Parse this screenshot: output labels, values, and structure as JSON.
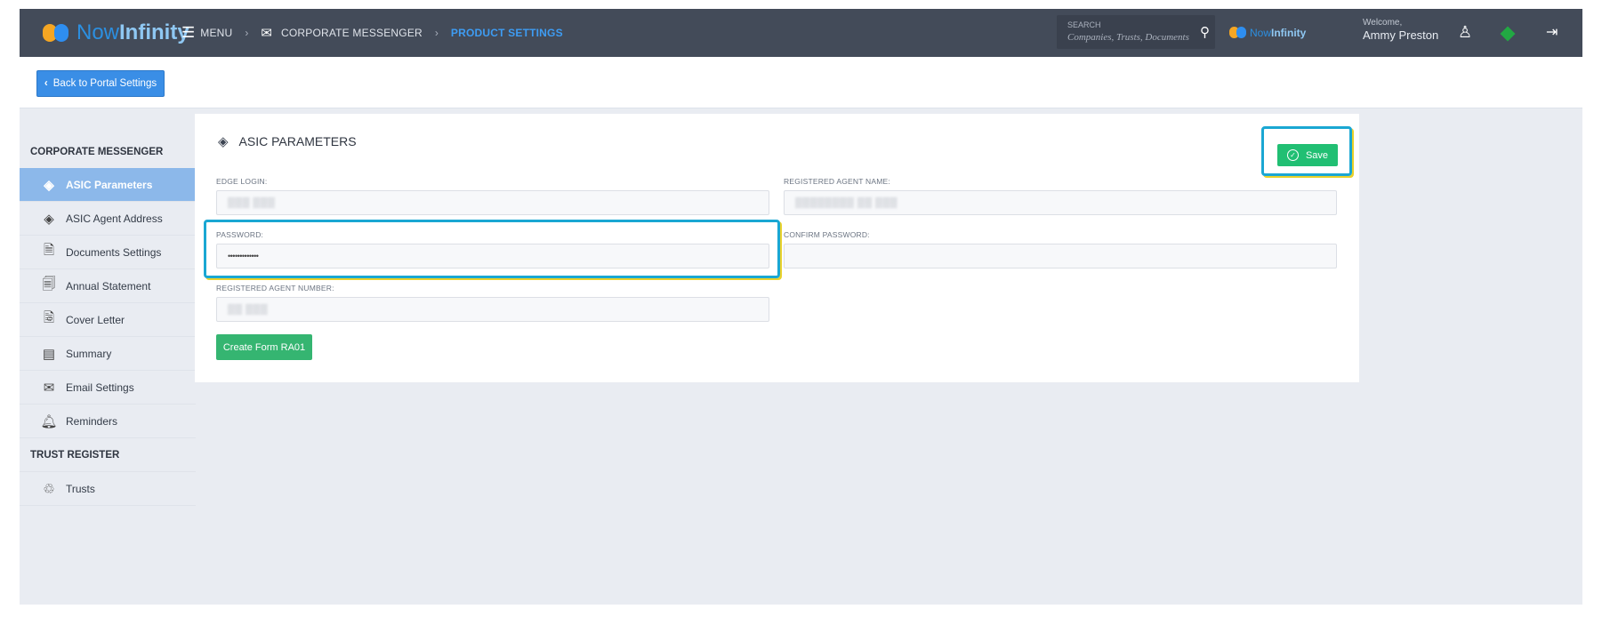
{
  "brand": {
    "now": "Now",
    "infinity": "Infinity"
  },
  "nav": {
    "menu": "MENU",
    "corporate_messenger": "CORPORATE MESSENGER",
    "product_settings": "PRODUCT SETTINGS",
    "sep1": "›",
    "sep2": "›"
  },
  "search": {
    "label": "SEARCH",
    "placeholder": "Companies, Trusts, Documents"
  },
  "mini_brand": {
    "now": "Now",
    "infinity": "Infinity"
  },
  "user": {
    "welcome": "Welcome,",
    "name": "Ammy Preston"
  },
  "back_button": "Back to Portal Settings",
  "sidebar": {
    "section1": "CORPORATE MESSENGER",
    "items": [
      {
        "label": "ASIC Parameters",
        "icon": "diamond-icon",
        "active": true
      },
      {
        "label": "ASIC Agent Address",
        "icon": "diamond-icon"
      },
      {
        "label": "Documents Settings",
        "icon": "document-settings-icon"
      },
      {
        "label": "Annual Statement",
        "icon": "statement-icon"
      },
      {
        "label": "Cover Letter",
        "icon": "cover-letter-icon"
      },
      {
        "label": "Summary",
        "icon": "summary-icon"
      },
      {
        "label": "Email Settings",
        "icon": "email-settings-icon"
      },
      {
        "label": "Reminders",
        "icon": "bell-icon"
      }
    ],
    "section2": "TRUST REGISTER",
    "items2": [
      {
        "label": "Trusts",
        "icon": "trusts-icon"
      }
    ]
  },
  "panel": {
    "title": "ASIC PARAMETERS",
    "save": "Save",
    "fields": {
      "edge_login": {
        "label": "EDGE LOGIN:",
        "value": "▒▒▒ ▒▒▒"
      },
      "registered_agent_name": {
        "label": "REGISTERED AGENT NAME:",
        "value": "▒▒▒▒▒▒▒▒ ▒▒ ▒▒▒"
      },
      "password": {
        "label": "PASSWORD:",
        "value": "•••••••••••••"
      },
      "confirm_password": {
        "label": "CONFIRM PASSWORD:",
        "value": ""
      },
      "registered_agent_number": {
        "label": "REGISTERED AGENT NUMBER:",
        "value": "▒▒ ▒▒▒"
      }
    },
    "create_form": "Create Form RA01"
  },
  "colors": {
    "accent": "#3a8ee6",
    "topbar": "#434b59",
    "save": "#21bf73",
    "create": "#35b571",
    "highlight": "#1aa7d3"
  }
}
